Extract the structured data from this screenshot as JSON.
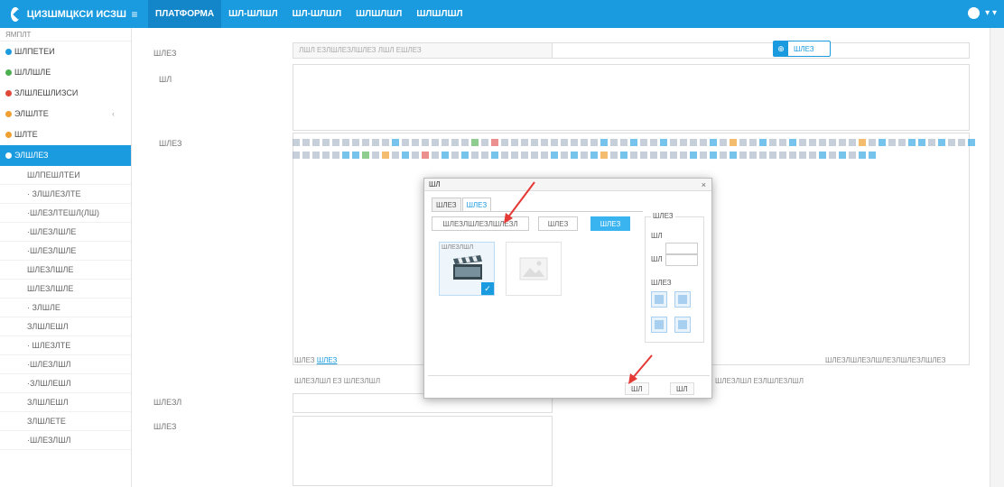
{
  "topbar": {
    "app_title": "ЦИЗШМЦКСИ ИСЗШ",
    "menu_glyph": "≡",
    "nav": [
      "ПЛАТФОРМА",
      "ШЛ-ШЛШЛ",
      "ШЛ-ШЛШЛ",
      "ШЛШЛШЛ",
      "ШЛШЛШЛ"
    ],
    "more": "▾ ▾"
  },
  "sidebar": {
    "header": "ЯМПЛТ",
    "items": [
      {
        "label": "ШЛПЕТЕИ",
        "color": "#1a9be0"
      },
      {
        "label": "ШЛЛШЛЕ",
        "color": "#4caf50"
      },
      {
        "label": "ЗЛШЛЕШЛИЗСИ",
        "color": "#e0493a"
      },
      {
        "label": "ЭЛШЛТЕ",
        "color": "#f0a030",
        "arrow": "‹"
      },
      {
        "label": "ШЛТЕ",
        "color": "#f0a030"
      },
      {
        "label": "ЭЛШЛЕЗ",
        "active": true
      }
    ],
    "subitems": [
      "ШЛПЕШЛТЕИ",
      "· ЗЛШЛЕЗЛТЕ",
      "·ШЛЕЗЛТЕШЛ(ЛШ)",
      "·ШЛЕЗЛШЛЕ",
      "·ШЛЕЗЛШЛЕ",
      "ШЛЕЗЛШЛЕ",
      "ШЛЕЗЛШЛЕ",
      "· ЗЛШЛЕ",
      "ЗЛШЛЕШЛ",
      "· ШЛЕЗЛТЕ",
      "·ШЛЕЗЛШЛ",
      "·ЗЛШЛЕШЛ",
      "ЗЛШЛЕШЛ",
      "ЗЛШЛЕТЕ",
      "·ШЛЕЗЛШЛ"
    ]
  },
  "form": {
    "row1_label": "ШЛЕЗ",
    "row1_value": "ЛШЛ ЕЗЛШЛЕЗЛШЛЕЗ ЛШЛ ЕШЛЕЗ",
    "row2_label": "ШЛ",
    "upload_button": "ШЛЕЗ",
    "upload_icon": "⊕",
    "row3_label": "ШЛЕЗ",
    "editor_foot_left_label": "ШЛЕЗ",
    "editor_foot_left_link": "ШЛЕЗ",
    "editor_foot_right": "ШЛЕЗЛШЛЕЗЛШЛЕЗЛШЛЕЗЛШЛЕЗ",
    "editor_opts_left": "ШЛЕЗЛШЛ ЕЗ  ШЛЕЗЛШЛ",
    "editor_opts_right": "ШЛЕЗЛШЛ ЕЗЛШЛЕЗЛШЛ",
    "row4_label": "ШЛЕЗЛ",
    "row5_label": "ШЛЕЗ"
  },
  "dialog": {
    "title": "ШЛ",
    "close": "×",
    "tabs": [
      "ШЛЕЗ",
      "ШЛЕЗ"
    ],
    "subtabs": [
      "ШЛЕЗЛШЛЕЗЛШЛЕЗЛ",
      "ШЛЕЗ",
      "ШЛЕЗ"
    ],
    "thumb_caption": "ШЛЕЗЛШЛ",
    "check": "✓",
    "panel_legend": "ШЛЕЗ",
    "panel_width_label": "ШЛ",
    "panel_height_label": "ШЛ",
    "panel_align_label": "ШЛЕЗ",
    "ok_button": "ШЛ",
    "cancel_button": "ШЛ"
  }
}
